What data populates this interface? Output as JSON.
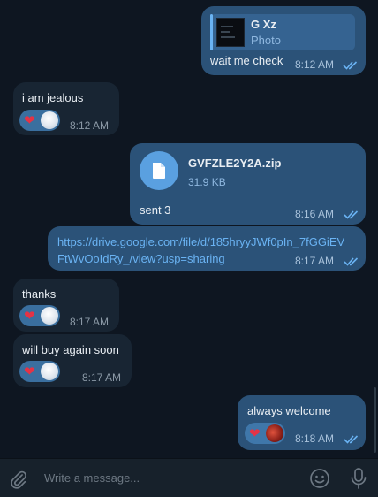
{
  "messages": [
    {
      "reply_name": "G Xz",
      "reply_type": "Photo",
      "text": "wait me check",
      "time": "8:12 AM"
    },
    {
      "text": "i am jealous",
      "time": "8:12 AM"
    },
    {
      "file_name": "GVFZLE2Y2A.zip",
      "file_size": "31.9 KB",
      "text": "sent 3",
      "time": "8:16 AM"
    },
    {
      "link_line1": "https://drive.google.com/file/d/185hryyJWf0pIn_7fGGiEV",
      "link_line2": "FtWvOoIdRy_/view?usp=sharing",
      "time": "8:17 AM"
    },
    {
      "text": "thanks",
      "time": "8:17 AM"
    },
    {
      "text": "will buy again soon",
      "time": "8:17 AM"
    },
    {
      "text": "always welcome",
      "time": "8:18 AM"
    }
  ],
  "composer": {
    "placeholder": "Write a message..."
  },
  "icons": {
    "attach": "paperclip-icon",
    "emoji": "smiley-icon",
    "mic": "microphone-icon",
    "file": "document-icon",
    "read": "double-check-icon"
  },
  "colors": {
    "background": "#0e1621",
    "incoming": "#182533",
    "outgoing": "#2b5278",
    "link": "#6ab3f3",
    "heart": "#e53346"
  }
}
